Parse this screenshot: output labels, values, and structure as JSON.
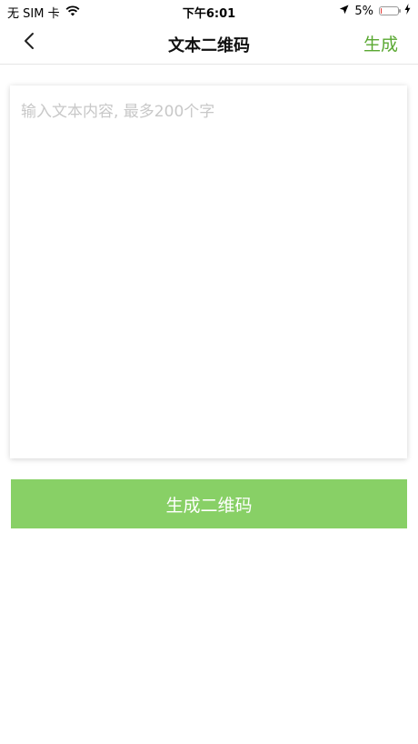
{
  "status_bar": {
    "carrier": "无 SIM 卡",
    "time": "下午6:01",
    "battery_percent": "5%",
    "battery_level": 0.05,
    "battery_color": "#e53935"
  },
  "nav": {
    "title": "文本二维码",
    "action_label": "生成",
    "back_icon": "chevron-left-icon"
  },
  "input": {
    "value": "",
    "placeholder": "输入文本内容, 最多200个字"
  },
  "generate_button": {
    "label": "生成二维码",
    "color": "#88d066"
  },
  "accent_color": "#5aa832"
}
